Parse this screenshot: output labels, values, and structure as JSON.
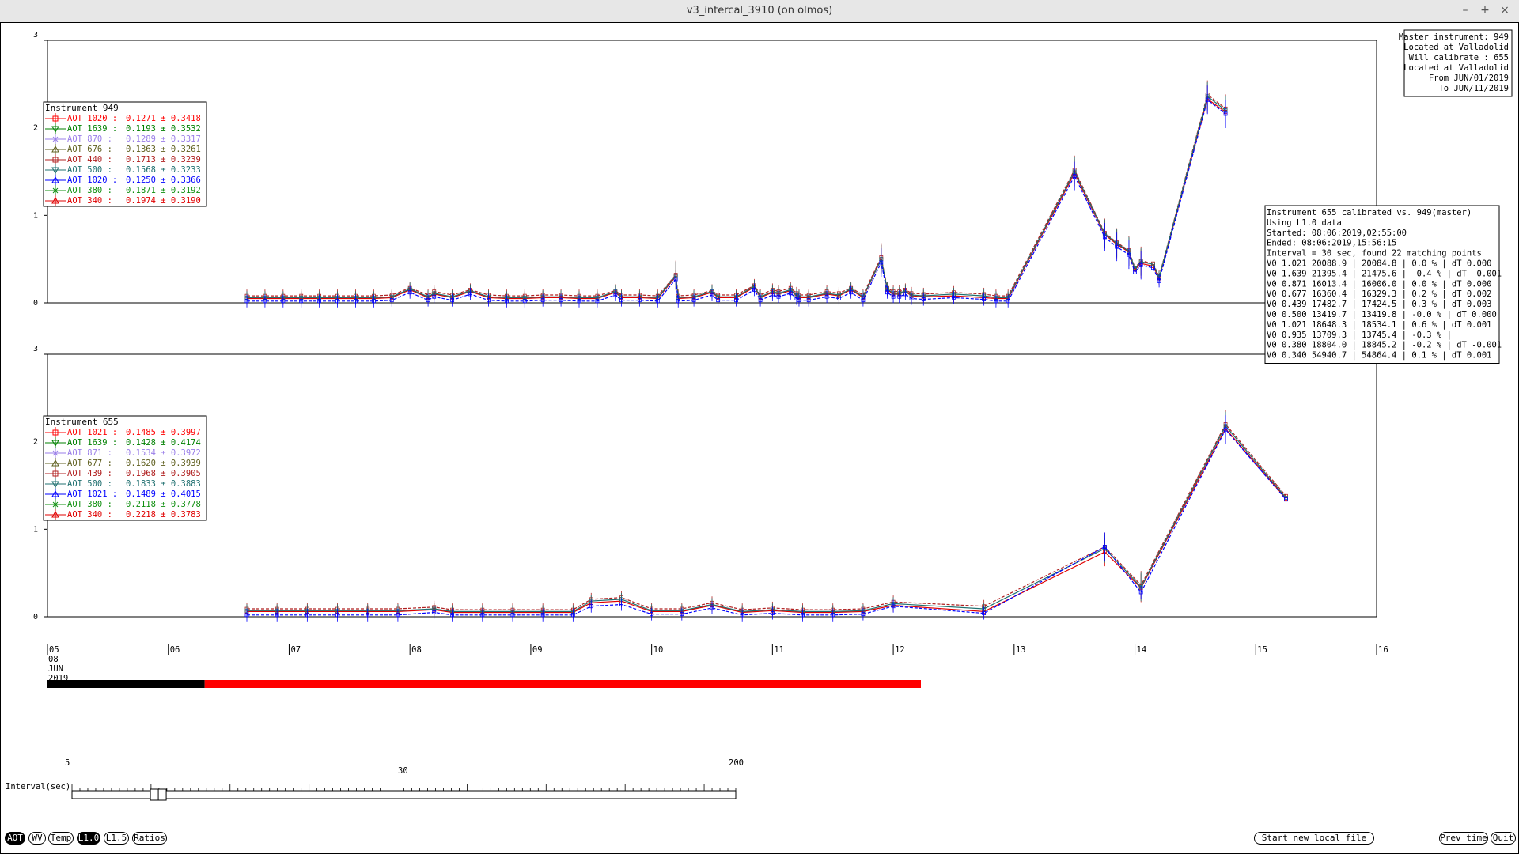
{
  "window": {
    "title": "v3_intercal_3910 (on olmos)",
    "btn_min": "–",
    "btn_max": "+",
    "btn_close": "×"
  },
  "colors": {
    "red": "#ff0000",
    "green": "#008000",
    "lilac": "#9a7ee8",
    "olive": "#606020",
    "brown": "#b02020",
    "teal": "#207070",
    "blue": "#0000ff",
    "green2": "#109010",
    "red2": "#e00000",
    "bar_done": "#000000",
    "bar_todo": "#ff0000"
  },
  "info_master": [
    "Master instrument: 949",
    "Located at Valladolid",
    "Will calibrate  : 655",
    "Located at Valladolid",
    "From JUN/01/2019",
    "To JUN/11/2019"
  ],
  "calib_box": {
    "lines": [
      "Instrument 655 calibrated vs. 949(master)",
      "Using L1.0 data",
      "Started: 08:06:2019,02:55:00",
      "Ended: 08:06:2019,15:56:15",
      "Interval = 30 sec, found 22 matching points",
      "V0 1.021  20088.9 | 20084.8 |  0.0 % | dT 0.000",
      "V0 1.639  21395.4 | 21475.6 | -0.4 % | dT -0.001",
      "V0 0.871  16013.4 | 16006.0 |  0.0 % | dT 0.000",
      "V0 0.677  16360.4 | 16329.3 |  0.2 % | dT 0.002",
      "V0 0.439  17482.7 | 17424.5 |  0.3 % | dT 0.003",
      "V0 0.500  13419.7 | 13419.8 | -0.0 % | dT 0.000",
      "V0 1.021  18648.3 | 18534.1 |  0.6 % | dT 0.001",
      "V0 0.935  13709.3 | 13745.4 | -0.3 % |",
      "V0 0.380  18804.0 | 18845.2 | -0.2 % | dT -0.001",
      "V0 0.340  54940.7 | 54864.4 |  0.1 % | dT 0.001"
    ]
  },
  "chart_data": [
    {
      "type": "line",
      "title": "",
      "ylim": [
        0,
        3
      ],
      "yticks": [
        "0",
        "1",
        "2",
        "3"
      ],
      "xlim": [
        5,
        16
      ],
      "legend_title": "Instrument 949",
      "legend": [
        {
          "label": "AOT 1020 :",
          "value": "0.1271 ± 0.3418",
          "color": "#ff0000",
          "marker": "square"
        },
        {
          "label": "AOT 1639 :",
          "value": "0.1193 ± 0.3532",
          "color": "#008000",
          "marker": "tri-down"
        },
        {
          "label": "AOT 870 :",
          "value": "0.1289 ± 0.3317",
          "color": "#9a7ee8",
          "marker": "x"
        },
        {
          "label": "AOT 676 :",
          "value": "0.1363 ± 0.3261",
          "color": "#606020",
          "marker": "tri-up"
        },
        {
          "label": "AOT 440 :",
          "value": "0.1713 ± 0.3239",
          "color": "#b02020",
          "marker": "square"
        },
        {
          "label": "AOT 500 :",
          "value": "0.1568 ± 0.3233",
          "color": "#207070",
          "marker": "tri-down"
        },
        {
          "label": "AOT 1020 :",
          "value": "0.1250 ± 0.3366",
          "color": "#0000ff",
          "marker": "tri-up"
        },
        {
          "label": "AOT 380 :",
          "value": "0.1871 ± 0.3192",
          "color": "#109010",
          "marker": "x"
        },
        {
          "label": "AOT 340 :",
          "value": "0.1974 ± 0.3190",
          "color": "#e00000",
          "marker": "tri-up"
        }
      ],
      "x": [
        6.65,
        6.8,
        6.95,
        7.1,
        7.25,
        7.4,
        7.55,
        7.7,
        7.85,
        8.0,
        8.15,
        8.2,
        8.35,
        8.5,
        8.65,
        8.8,
        8.95,
        9.1,
        9.25,
        9.4,
        9.55,
        9.7,
        9.75,
        9.9,
        10.05,
        10.2,
        10.22,
        10.35,
        10.5,
        10.55,
        10.7,
        10.85,
        10.9,
        11.0,
        11.05,
        11.15,
        11.2,
        11.22,
        11.3,
        11.45,
        11.55,
        11.65,
        11.75,
        11.9,
        11.95,
        12.0,
        12.05,
        12.1,
        12.15,
        12.25,
        12.5,
        12.75,
        12.85,
        12.95,
        13.5,
        13.75,
        13.85,
        13.95,
        14.0,
        14.05,
        14.15,
        14.2,
        14.6,
        14.75
      ],
      "series": [
        {
          "name": "AOT 340",
          "color": "#e00000",
          "values": [
            0.05,
            0.05,
            0.05,
            0.05,
            0.05,
            0.05,
            0.05,
            0.05,
            0.06,
            0.15,
            0.06,
            0.1,
            0.06,
            0.13,
            0.06,
            0.05,
            0.05,
            0.06,
            0.06,
            0.05,
            0.05,
            0.12,
            0.06,
            0.06,
            0.05,
            0.3,
            0.05,
            0.06,
            0.12,
            0.06,
            0.06,
            0.18,
            0.06,
            0.12,
            0.1,
            0.14,
            0.08,
            0.06,
            0.06,
            0.1,
            0.08,
            0.15,
            0.06,
            0.5,
            0.15,
            0.1,
            0.1,
            0.13,
            0.08,
            0.07,
            0.08,
            0.06,
            0.05,
            0.05,
            1.48,
            0.78,
            0.67,
            0.58,
            0.38,
            0.45,
            0.42,
            0.28,
            2.33,
            2.18
          ]
        },
        {
          "name": "AOT 440",
          "color": "#b02020",
          "values": [
            0.08,
            0.08,
            0.08,
            0.08,
            0.08,
            0.08,
            0.08,
            0.08,
            0.09,
            0.17,
            0.09,
            0.13,
            0.09,
            0.15,
            0.09,
            0.08,
            0.08,
            0.09,
            0.09,
            0.08,
            0.08,
            0.14,
            0.09,
            0.09,
            0.08,
            0.32,
            0.08,
            0.09,
            0.14,
            0.09,
            0.09,
            0.2,
            0.09,
            0.15,
            0.13,
            0.17,
            0.11,
            0.09,
            0.09,
            0.13,
            0.11,
            0.17,
            0.09,
            0.52,
            0.17,
            0.13,
            0.13,
            0.15,
            0.11,
            0.1,
            0.12,
            0.1,
            0.08,
            0.08,
            1.52,
            0.8,
            0.69,
            0.6,
            0.4,
            0.48,
            0.45,
            0.3,
            2.38,
            2.22
          ]
        },
        {
          "name": "AOT 500",
          "color": "#207070",
          "values": [
            0.06,
            0.06,
            0.06,
            0.06,
            0.06,
            0.06,
            0.06,
            0.06,
            0.07,
            0.16,
            0.07,
            0.11,
            0.07,
            0.14,
            0.07,
            0.06,
            0.06,
            0.07,
            0.07,
            0.06,
            0.06,
            0.13,
            0.07,
            0.07,
            0.06,
            0.31,
            0.06,
            0.07,
            0.13,
            0.07,
            0.07,
            0.19,
            0.07,
            0.13,
            0.11,
            0.15,
            0.09,
            0.07,
            0.07,
            0.11,
            0.09,
            0.16,
            0.07,
            0.5,
            0.16,
            0.11,
            0.11,
            0.14,
            0.09,
            0.08,
            0.1,
            0.08,
            0.06,
            0.06,
            1.5,
            0.79,
            0.68,
            0.59,
            0.39,
            0.47,
            0.44,
            0.29,
            2.36,
            2.2
          ]
        },
        {
          "name": "AOT 1020",
          "color": "#0000ff",
          "values": [
            0.02,
            0.02,
            0.02,
            0.02,
            0.02,
            0.02,
            0.02,
            0.02,
            0.03,
            0.12,
            0.03,
            0.07,
            0.03,
            0.1,
            0.03,
            0.02,
            0.02,
            0.03,
            0.03,
            0.02,
            0.02,
            0.09,
            0.03,
            0.03,
            0.02,
            0.27,
            0.02,
            0.03,
            0.09,
            0.03,
            0.03,
            0.15,
            0.03,
            0.09,
            0.07,
            0.11,
            0.05,
            0.03,
            0.03,
            0.07,
            0.05,
            0.12,
            0.03,
            0.46,
            0.12,
            0.07,
            0.07,
            0.1,
            0.05,
            0.04,
            0.06,
            0.04,
            0.02,
            0.02,
            1.45,
            0.75,
            0.64,
            0.55,
            0.35,
            0.43,
            0.4,
            0.25,
            2.32,
            2.16
          ]
        }
      ]
    },
    {
      "type": "line",
      "title": "",
      "ylim": [
        0,
        3
      ],
      "yticks": [
        "0",
        "1",
        "2",
        "3"
      ],
      "xlim": [
        5,
        16
      ],
      "legend_title": "Instrument 655",
      "legend": [
        {
          "label": "AOT 1021 :",
          "value": "0.1485 ± 0.3997",
          "color": "#ff0000",
          "marker": "square"
        },
        {
          "label": "AOT 1639 :",
          "value": "0.1428 ± 0.4174",
          "color": "#008000",
          "marker": "tri-down"
        },
        {
          "label": "AOT 871 :",
          "value": "0.1534 ± 0.3972",
          "color": "#9a7ee8",
          "marker": "x"
        },
        {
          "label": "AOT 677 :",
          "value": "0.1620 ± 0.3939",
          "color": "#606020",
          "marker": "tri-up"
        },
        {
          "label": "AOT 439 :",
          "value": "0.1968 ± 0.3905",
          "color": "#b02020",
          "marker": "square"
        },
        {
          "label": "AOT 500 :",
          "value": "0.1833 ± 0.3883",
          "color": "#207070",
          "marker": "tri-down"
        },
        {
          "label": "AOT 1021 :",
          "value": "0.1489 ± 0.4015",
          "color": "#0000ff",
          "marker": "tri-up"
        },
        {
          "label": "AOT 380 :",
          "value": "0.2118 ± 0.3778",
          "color": "#109010",
          "marker": "x"
        },
        {
          "label": "AOT 340 :",
          "value": "0.2218 ± 0.3783",
          "color": "#e00000",
          "marker": "tri-up"
        }
      ],
      "x": [
        6.65,
        6.9,
        7.15,
        7.4,
        7.65,
        7.9,
        8.2,
        8.35,
        8.6,
        8.85,
        9.1,
        9.35,
        9.5,
        9.75,
        10.0,
        10.25,
        10.5,
        10.75,
        11.0,
        11.25,
        11.5,
        11.75,
        12.0,
        12.75,
        13.75,
        14.05,
        14.75,
        15.25
      ],
      "series": [
        {
          "name": "AOT 340",
          "color": "#e00000",
          "values": [
            0.06,
            0.06,
            0.06,
            0.06,
            0.06,
            0.06,
            0.08,
            0.05,
            0.05,
            0.05,
            0.05,
            0.05,
            0.16,
            0.18,
            0.06,
            0.06,
            0.13,
            0.05,
            0.07,
            0.05,
            0.05,
            0.06,
            0.13,
            0.06,
            0.74,
            0.33,
            2.15,
            1.35
          ]
        },
        {
          "name": "AOT 440",
          "color": "#b02020",
          "values": [
            0.09,
            0.09,
            0.09,
            0.09,
            0.09,
            0.09,
            0.11,
            0.08,
            0.08,
            0.08,
            0.08,
            0.08,
            0.2,
            0.22,
            0.09,
            0.09,
            0.16,
            0.08,
            0.1,
            0.08,
            0.08,
            0.09,
            0.17,
            0.12,
            0.8,
            0.36,
            2.2,
            1.38
          ]
        },
        {
          "name": "AOT 500",
          "color": "#207070",
          "values": [
            0.07,
            0.07,
            0.07,
            0.07,
            0.07,
            0.07,
            0.09,
            0.06,
            0.06,
            0.06,
            0.06,
            0.06,
            0.18,
            0.2,
            0.07,
            0.07,
            0.14,
            0.06,
            0.08,
            0.06,
            0.06,
            0.07,
            0.15,
            0.09,
            0.78,
            0.34,
            2.18,
            1.36
          ]
        },
        {
          "name": "AOT 1021",
          "color": "#0000ff",
          "values": [
            0.02,
            0.02,
            0.02,
            0.02,
            0.02,
            0.02,
            0.05,
            0.02,
            0.02,
            0.02,
            0.02,
            0.02,
            0.12,
            0.14,
            0.03,
            0.03,
            0.1,
            0.02,
            0.04,
            0.02,
            0.02,
            0.03,
            0.12,
            0.04,
            0.8,
            0.28,
            2.14,
            1.34
          ]
        }
      ]
    }
  ],
  "xaxis": {
    "ticks": [
      "05",
      "06",
      "07",
      "08",
      "09",
      "10",
      "11",
      "12",
      "13",
      "14",
      "15",
      "16"
    ],
    "date_lines": [
      "08",
      "JUN",
      "2019"
    ]
  },
  "progress": {
    "fraction": 0.18
  },
  "slider": {
    "label": "Interval(sec)",
    "min": "5",
    "mid": "30",
    "max": "200",
    "value_fraction": 0.13
  },
  "buttons": {
    "aot": "AOT",
    "wv": "WV",
    "temp": "Temp",
    "l10": "L1.0",
    "l15": "L1.5",
    "ratios": "Ratios",
    "new_file": "Start new local file",
    "prev": "Prev time",
    "quit": "Quit"
  }
}
